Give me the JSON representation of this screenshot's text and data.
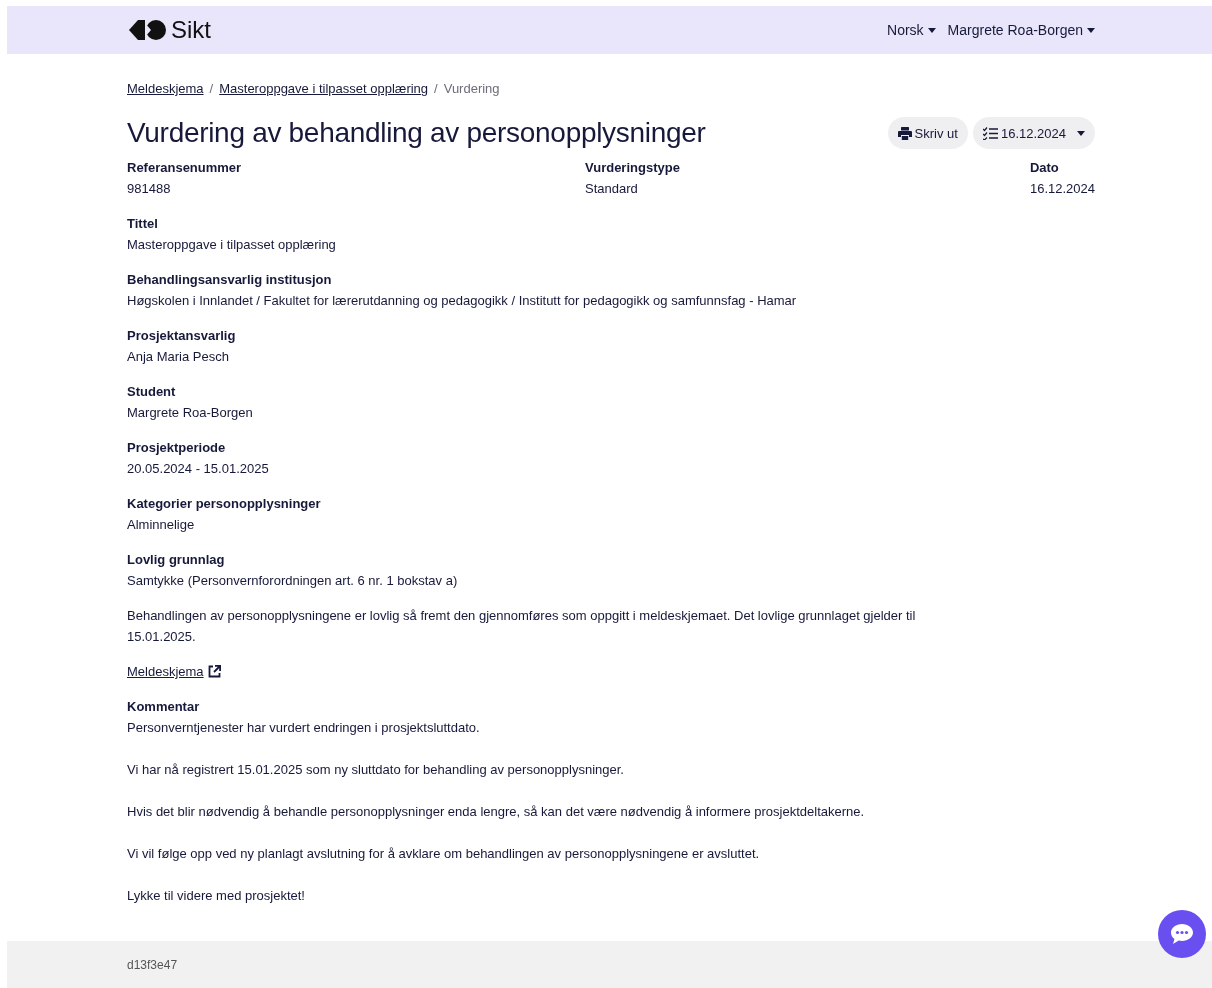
{
  "header": {
    "logo_text": "Sikt",
    "menus": [
      {
        "label": "Norsk"
      },
      {
        "label": "Margrete Roa-Borgen"
      }
    ]
  },
  "breadcrumb": [
    {
      "label": "Meldeskjema",
      "kind": "link"
    },
    {
      "label": "Masteroppgave i tilpasset opplæring",
      "kind": "link"
    },
    {
      "label": "Vurdering",
      "kind": "current"
    }
  ],
  "breadcrumb_separator": "/",
  "title": "Vurdering av behandling av personopplysninger",
  "actions": {
    "print_button": "Skriv ut",
    "version_dropdown": "16.12.2024"
  },
  "summary": [
    {
      "label": "Referansenummer",
      "value": "981488"
    },
    {
      "label": "Vurderingstype",
      "value": "Standard"
    },
    {
      "label": "Dato",
      "value": "16.12.2024"
    }
  ],
  "fields": [
    {
      "label": "Tittel",
      "value": "Masteroppgave i tilpasset opplæring"
    },
    {
      "label": "Behandlingsansvarlig institusjon",
      "value": "Høgskolen i Innlandet / Fakultet for lærerutdanning og pedagogikk / Institutt for pedagogikk og samfunnsfag - Hamar"
    },
    {
      "label": "Prosjektansvarlig",
      "value": "Anja Maria Pesch"
    },
    {
      "label": "Student",
      "value": "Margrete Roa-Borgen"
    },
    {
      "label": "Prosjektperiode",
      "value": "20.05.2024 - 15.01.2025"
    },
    {
      "label": "Kategorier personopplysninger",
      "value": "Alminnelige"
    },
    {
      "label": "Lovlig grunnlag",
      "value": "Samtykke (Personvernforordningen art. 6 nr. 1 bokstav a)"
    }
  ],
  "legal_note": "Behandlingen av personopplysningene er lovlig så fremt den gjennomføres som oppgitt i meldeskjemaet. Det lovlige grunnlaget gjelder til 15.01.2025.",
  "form_link": "Meldeskjema",
  "comment": {
    "label": "Kommentar",
    "paragraphs": [
      "Personverntjenester har vurdert endringen i prosjektsluttdato.",
      "Vi har nå registrert 15.01.2025 som ny sluttdato for behandling av personopplysninger.",
      "Hvis det blir nødvendig å behandle personopplysninger enda lengre, så kan det være nødvendig å informere prosjektdeltakerne.",
      "Vi vil følge opp ved ny planlagt avslutning for å avklare om behandlingen av personopplysningene er avsluttet.",
      "Lykke til videre med prosjektet!"
    ]
  },
  "footer": {
    "build_id": "d13f3e47"
  }
}
